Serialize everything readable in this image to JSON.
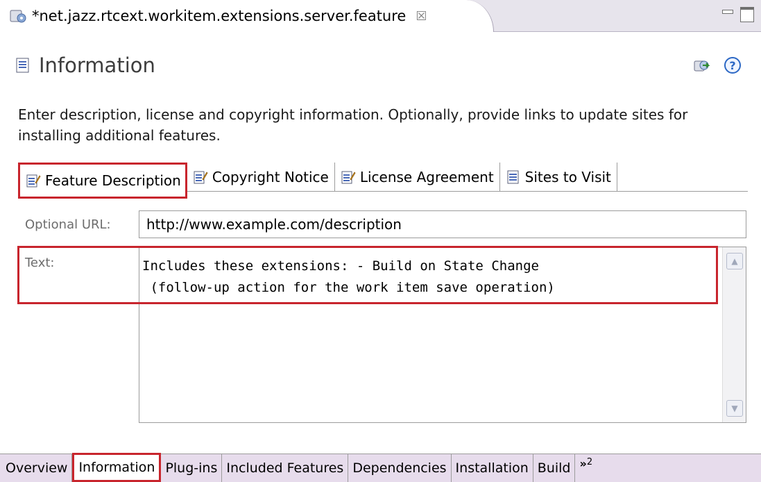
{
  "editor_tab": {
    "title": "*net.jazz.rtcext.workitem.extensions.server.feature",
    "close_glyph": "☒"
  },
  "section": {
    "title": "Information"
  },
  "description": "Enter description, license and copyright information. Optionally, provide links to update sites for installing additional features.",
  "info_tabs": [
    {
      "label": "Feature Description",
      "icon": "edit-document-icon",
      "selected": true
    },
    {
      "label": "Copyright Notice",
      "icon": "edit-document-icon"
    },
    {
      "label": "License Agreement",
      "icon": "edit-document-icon"
    },
    {
      "label": "Sites to Visit",
      "icon": "document-icon"
    }
  ],
  "url": {
    "label": "Optional URL:",
    "value": "http://www.example.com/description"
  },
  "text": {
    "label": "Text:",
    "value": "Includes these extensions: - Build on State Change\n (follow-up action for the work item save operation)"
  },
  "page_tabs": [
    {
      "label": "Overview"
    },
    {
      "label": "Information",
      "selected": true
    },
    {
      "label": "Plug-ins"
    },
    {
      "label": "Included Features"
    },
    {
      "label": "Dependencies"
    },
    {
      "label": "Installation"
    },
    {
      "label": "Build"
    }
  ],
  "overflow": {
    "glyph": "»",
    "count": "2"
  },
  "colors": {
    "highlight": "#c8252d",
    "tabbar": "#e7dcec",
    "help": "#2b67c4"
  }
}
